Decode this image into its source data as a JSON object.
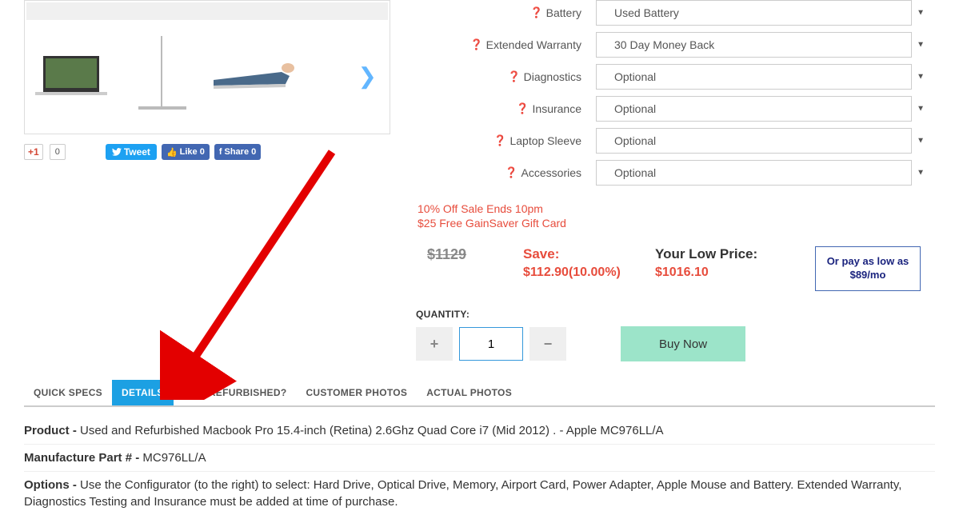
{
  "config": {
    "battery": {
      "label": "Battery",
      "value": "Used Battery"
    },
    "warranty": {
      "label": "Extended Warranty",
      "value": "30 Day Money Back"
    },
    "diagnostics": {
      "label": "Diagnostics",
      "value": "Optional"
    },
    "insurance": {
      "label": "Insurance",
      "value": "Optional"
    },
    "sleeve": {
      "label": "Laptop Sleeve",
      "value": "Optional"
    },
    "accessories": {
      "label": "Accessories",
      "value": "Optional"
    }
  },
  "promo": {
    "line1": "10% Off Sale Ends 10pm",
    "line2": "$25 Free GainSaver Gift Card"
  },
  "pricing": {
    "old_price": "$1129",
    "save_label": "Save:",
    "save_amount": "$112.90(10.00%)",
    "your_price_label": "Your Low Price:",
    "your_price": "$1016.10",
    "financing": "Or pay as low as $89/mo"
  },
  "quantity": {
    "label": "QUANTITY:",
    "value": "1",
    "buy_label": "Buy Now"
  },
  "social": {
    "gplus": "+1",
    "gplus_count": "0",
    "tweet": "Tweet",
    "like": "Like 0",
    "share": "Share 0"
  },
  "tabs": {
    "quick_specs": "QUICK SPECS",
    "details": "DETAILS",
    "why_refurb": "WHY REFURBISHED?",
    "customer_photos": "CUSTOMER PHOTOS",
    "actual_photos": "ACTUAL PHOTOS"
  },
  "details": {
    "product_label": "Product - ",
    "product_value": "Used and Refurbished Macbook Pro 15.4-inch (Retina) 2.6Ghz Quad Core i7 (Mid 2012) . - Apple MC976LL/A",
    "partno_label": "Manufacture Part # - ",
    "partno_value": "MC976LL/A",
    "options_label": "Options - ",
    "options_value": "Use the Configurator (to the right) to select: Hard Drive, Optical Drive, Memory, Airport Card, Power Adapter, Apple Mouse and Battery. Extended Warranty, Diagnostics Testing and Insurance must be added at time of purchase."
  }
}
